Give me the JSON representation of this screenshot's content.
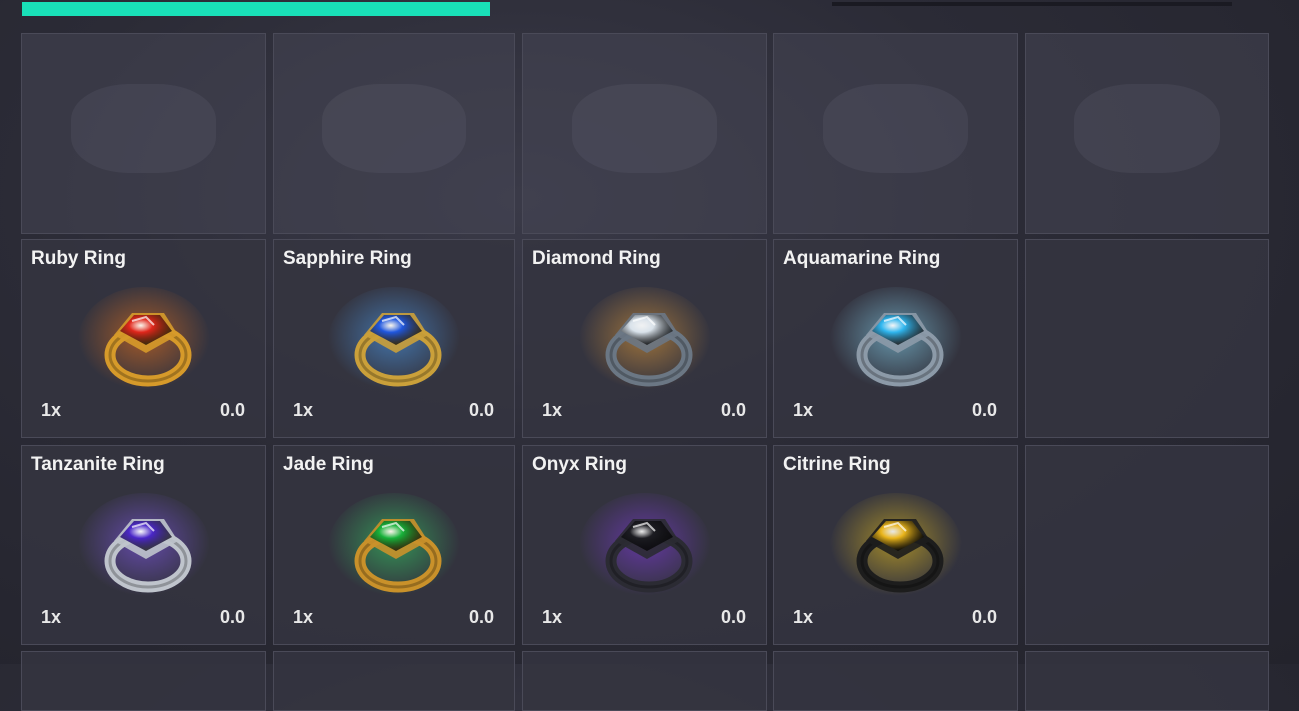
{
  "progress": {
    "fraction": 0.376,
    "color": "#19e0b8"
  },
  "rows": [
    {
      "items": [
        {
          "empty": true,
          "blurred": true
        },
        {
          "empty": true,
          "blurred": true
        },
        {
          "empty": true,
          "blurred": true
        },
        {
          "empty": true,
          "blurred": true
        },
        {
          "empty": true,
          "blurred": true
        }
      ]
    },
    {
      "items": [
        {
          "name": "Ruby Ring",
          "qty": "1x",
          "value": "0.0",
          "icon": "ruby-ring-icon",
          "gem": "#e0261b",
          "glow": "#ff7a18",
          "band": "#d69a2a"
        },
        {
          "name": "Sapphire Ring",
          "qty": "1x",
          "value": "0.0",
          "icon": "sapphire-ring-icon",
          "gem": "#1f57e0",
          "glow": "#4fa7ff",
          "band": "#caa03a"
        },
        {
          "name": "Diamond Ring",
          "qty": "1x",
          "value": "0.0",
          "icon": "diamond-ring-icon",
          "gem": "#d9e2ea",
          "glow": "#f0a43a",
          "band": "#6b7784"
        },
        {
          "name": "Aquamarine Ring",
          "qty": "1x",
          "value": "0.0",
          "icon": "aquamarine-ring-icon",
          "gem": "#2fb6ef",
          "glow": "#8fe3ff",
          "band": "#8c9aa8"
        },
        {
          "empty": true
        }
      ]
    },
    {
      "items": [
        {
          "name": "Tanzanite Ring",
          "qty": "1x",
          "value": "0.0",
          "icon": "tanzanite-ring-icon",
          "gem": "#4a26c9",
          "glow": "#8a5cff",
          "band": "#bfc4cc"
        },
        {
          "name": "Jade Ring",
          "qty": "1x",
          "value": "0.0",
          "icon": "jade-ring-icon",
          "gem": "#17b23a",
          "glow": "#36e06a",
          "band": "#c9912a"
        },
        {
          "name": "Onyx Ring",
          "qty": "1x",
          "value": "0.0",
          "icon": "onyx-ring-icon",
          "gem": "#1c1c22",
          "glow": "#8a3df0",
          "band": "#2b2b33"
        },
        {
          "name": "Citrine Ring",
          "qty": "1x",
          "value": "0.0",
          "icon": "citrine-ring-icon",
          "gem": "#e9b41a",
          "glow": "#ffd21a",
          "band": "#1d1d1d"
        },
        {
          "empty": true
        }
      ]
    },
    {
      "items": [
        {
          "empty": true
        },
        {
          "empty": true
        },
        {
          "empty": true
        },
        {
          "empty": true
        },
        {
          "empty": true
        }
      ]
    }
  ]
}
